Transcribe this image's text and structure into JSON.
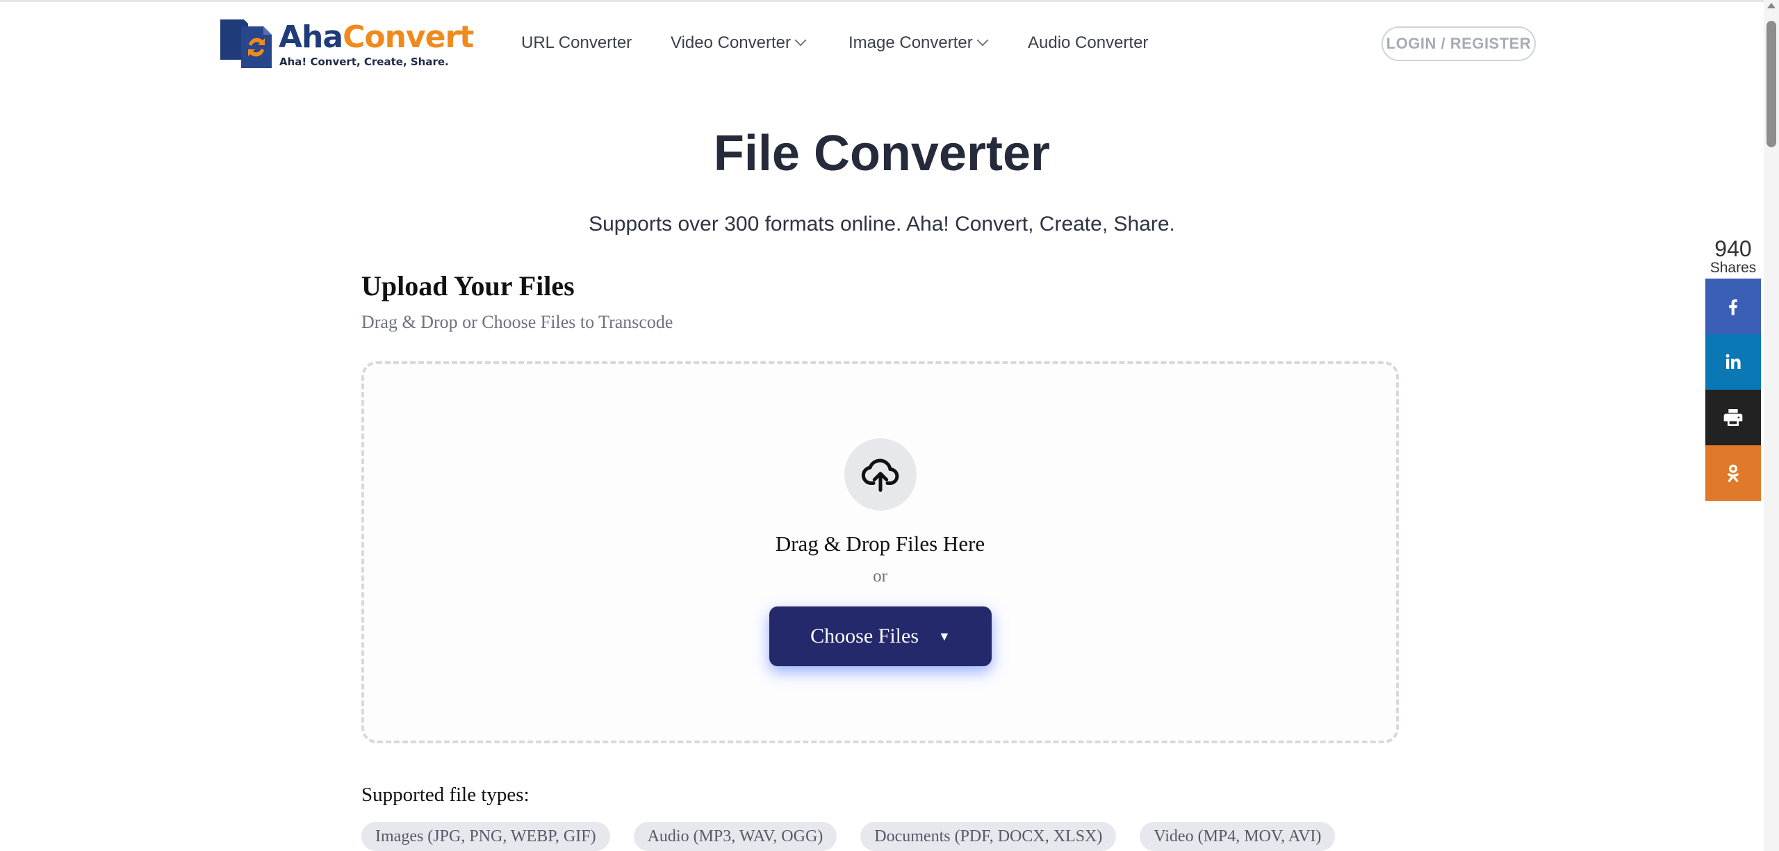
{
  "header": {
    "logo_part1": "Aha",
    "logo_part2": "Convert",
    "logo_tagline": "Aha! Convert, Create, Share.",
    "nav": [
      {
        "label": "URL Converter"
      },
      {
        "label": "Video Converter"
      },
      {
        "label": "Image Converter"
      },
      {
        "label": "Audio Converter"
      }
    ],
    "login_label": "LOGIN / REGISTER"
  },
  "main": {
    "title": "File Converter",
    "subtitle": "Supports over 300 formats online. Aha! Convert, Create, Share.",
    "upload_heading": "Upload Your Files",
    "upload_sub": "Drag & Drop or Choose Files to Transcode",
    "drop_text": "Drag & Drop Files Here",
    "or_text": "or",
    "choose_label": "Choose Files",
    "choose_caret": "▼",
    "supported_label": "Supported file types:",
    "chips": [
      "Images (JPG, PNG, WEBP, GIF)",
      "Audio (MP3, WAV, OGG)",
      "Documents (PDF, DOCX, XLSX)",
      "Video (MP4, MOV, AVI)"
    ]
  },
  "share": {
    "count": "940",
    "label": "Shares",
    "buttons": [
      {
        "icon": "facebook-icon",
        "color": "#3b5fb4"
      },
      {
        "icon": "linkedin-icon",
        "color": "#0a78b5"
      },
      {
        "icon": "print-icon",
        "color": "#222222"
      },
      {
        "icon": "odnoklassniki-icon",
        "color": "#e07a2a"
      }
    ]
  },
  "colors": {
    "brand_blue": "#1f3b7a",
    "brand_orange": "#f08a1c",
    "button": "#23296a"
  }
}
